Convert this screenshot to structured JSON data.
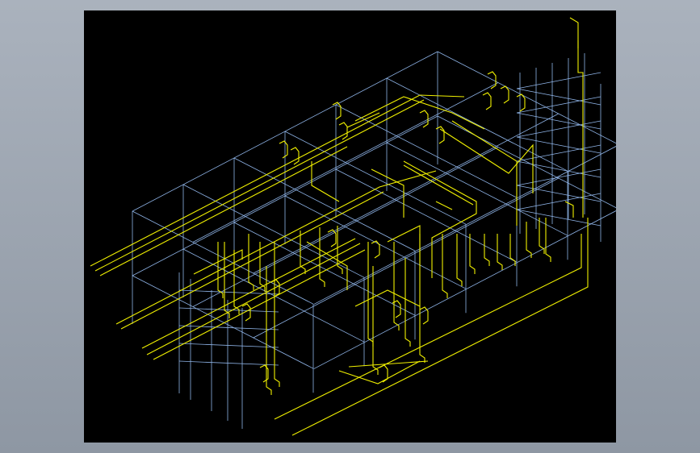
{
  "colors": {
    "background": "#98a1ad",
    "viewport": "#000000",
    "frame": "#8fb4e8",
    "pipe": "#f0f000"
  }
}
